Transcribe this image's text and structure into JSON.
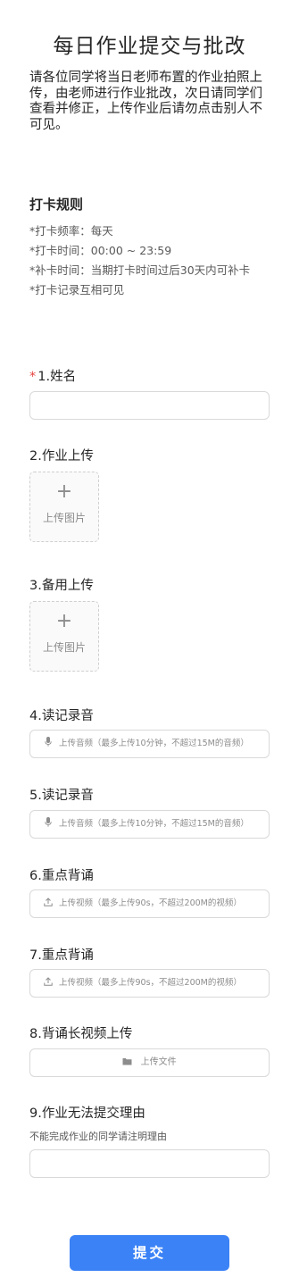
{
  "form": {
    "title": "每日作业提交与批改",
    "intro": "请各位同学将当日老师布置的作业拍照上传，由老师进行作业批改，次日请同学们查看并修正，上传作业后请勿点击别人不可见。"
  },
  "rules": {
    "title": "打卡规则",
    "items": [
      "*打卡频率：每天",
      "*打卡时间：00:00 ~ 23:59",
      "*补卡时间：当期打卡时间过后30天内可补卡",
      "*打卡记录互相可见"
    ]
  },
  "questions": {
    "q1": {
      "required_mark": "*",
      "label": "1.姓名"
    },
    "q2": {
      "label": "2.作业上传",
      "upload_text": "上传图片",
      "plus": "+"
    },
    "q3": {
      "label": "3.备用上传",
      "upload_text": "上传图片",
      "plus": "+"
    },
    "q4": {
      "label": "4.读记录音",
      "button_text": "上传音频（最多上传10分钟，不超过15M的音频）"
    },
    "q5": {
      "label": "5.读记录音",
      "button_text": "上传音频（最多上传10分钟，不超过15M的音频）"
    },
    "q6": {
      "label": "6.重点背诵",
      "button_text": "上传视频（最多上传90s，不超过200M的视频）"
    },
    "q7": {
      "label": "7.重点背诵",
      "button_text": "上传视频（最多上传90s，不超过200M的视频）"
    },
    "q8": {
      "label": "8.背诵长视频上传",
      "button_text": "上传文件"
    },
    "q9": {
      "label": "9.作业无法提交理由",
      "description": "不能完成作业的同学请注明理由"
    }
  },
  "icons": {
    "audio": "microphone-icon",
    "video": "upload-arrow-icon",
    "file": "folder-icon",
    "image": "plus-icon"
  },
  "submit": {
    "label": "提交"
  },
  "colors": {
    "accent": "#3b82f6",
    "required": "#e64340"
  }
}
